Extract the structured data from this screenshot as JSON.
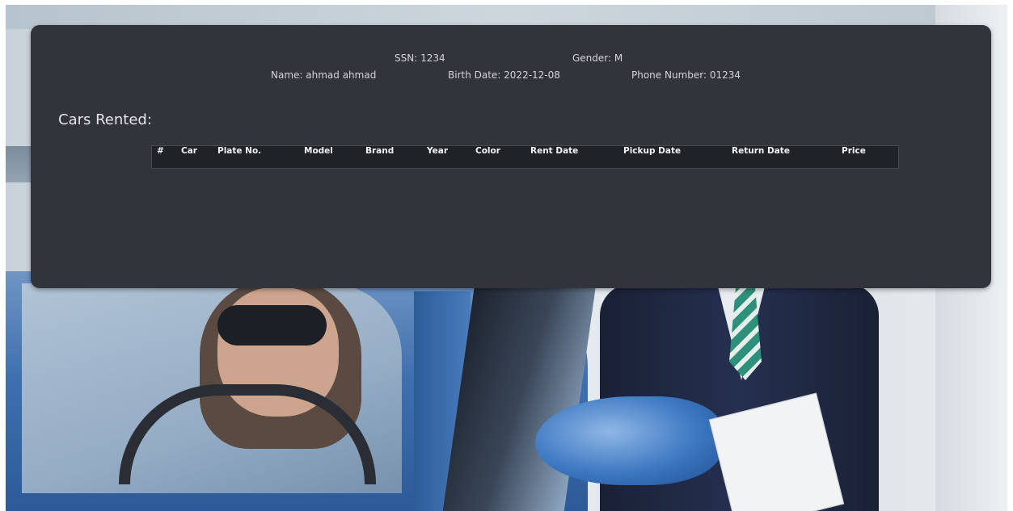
{
  "customer": {
    "ssn": "SSN: 1234",
    "gender": "Gender: M",
    "name": "Name: ahmad ahmad",
    "birth_date": "Birth Date: 2022-12-08",
    "phone": "Phone Number: 01234"
  },
  "rentals": {
    "title": "Cars Rented:",
    "columns": [
      "#",
      "Car",
      "Plate No.",
      "Model",
      "Brand",
      "Year",
      "Color",
      "Rent Date",
      "Pickup Date",
      "Return Date",
      "Price"
    ],
    "rows": []
  },
  "colors": {
    "panel_bg": "#31343b",
    "table_header_bg": "#1f2227"
  }
}
